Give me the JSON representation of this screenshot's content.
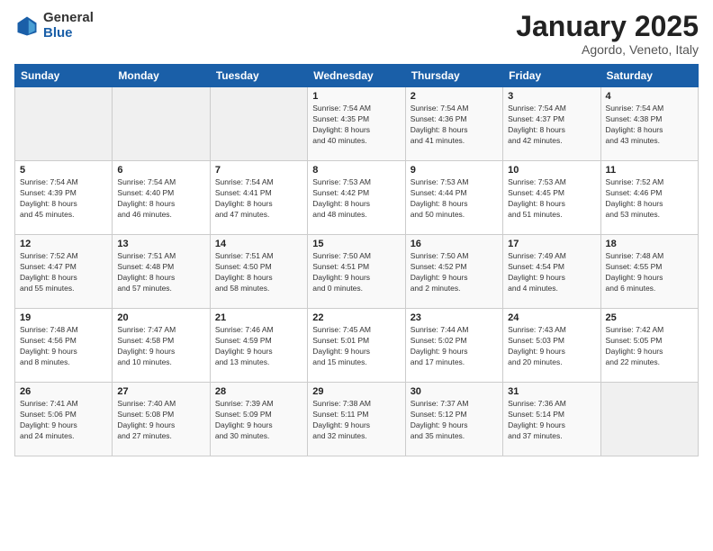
{
  "header": {
    "logo_general": "General",
    "logo_blue": "Blue",
    "month_title": "January 2025",
    "location": "Agordo, Veneto, Italy"
  },
  "weekdays": [
    "Sunday",
    "Monday",
    "Tuesday",
    "Wednesday",
    "Thursday",
    "Friday",
    "Saturday"
  ],
  "weeks": [
    [
      {
        "day": "",
        "info": ""
      },
      {
        "day": "",
        "info": ""
      },
      {
        "day": "",
        "info": ""
      },
      {
        "day": "1",
        "info": "Sunrise: 7:54 AM\nSunset: 4:35 PM\nDaylight: 8 hours\nand 40 minutes."
      },
      {
        "day": "2",
        "info": "Sunrise: 7:54 AM\nSunset: 4:36 PM\nDaylight: 8 hours\nand 41 minutes."
      },
      {
        "day": "3",
        "info": "Sunrise: 7:54 AM\nSunset: 4:37 PM\nDaylight: 8 hours\nand 42 minutes."
      },
      {
        "day": "4",
        "info": "Sunrise: 7:54 AM\nSunset: 4:38 PM\nDaylight: 8 hours\nand 43 minutes."
      }
    ],
    [
      {
        "day": "5",
        "info": "Sunrise: 7:54 AM\nSunset: 4:39 PM\nDaylight: 8 hours\nand 45 minutes."
      },
      {
        "day": "6",
        "info": "Sunrise: 7:54 AM\nSunset: 4:40 PM\nDaylight: 8 hours\nand 46 minutes."
      },
      {
        "day": "7",
        "info": "Sunrise: 7:54 AM\nSunset: 4:41 PM\nDaylight: 8 hours\nand 47 minutes."
      },
      {
        "day": "8",
        "info": "Sunrise: 7:53 AM\nSunset: 4:42 PM\nDaylight: 8 hours\nand 48 minutes."
      },
      {
        "day": "9",
        "info": "Sunrise: 7:53 AM\nSunset: 4:44 PM\nDaylight: 8 hours\nand 50 minutes."
      },
      {
        "day": "10",
        "info": "Sunrise: 7:53 AM\nSunset: 4:45 PM\nDaylight: 8 hours\nand 51 minutes."
      },
      {
        "day": "11",
        "info": "Sunrise: 7:52 AM\nSunset: 4:46 PM\nDaylight: 8 hours\nand 53 minutes."
      }
    ],
    [
      {
        "day": "12",
        "info": "Sunrise: 7:52 AM\nSunset: 4:47 PM\nDaylight: 8 hours\nand 55 minutes."
      },
      {
        "day": "13",
        "info": "Sunrise: 7:51 AM\nSunset: 4:48 PM\nDaylight: 8 hours\nand 57 minutes."
      },
      {
        "day": "14",
        "info": "Sunrise: 7:51 AM\nSunset: 4:50 PM\nDaylight: 8 hours\nand 58 minutes."
      },
      {
        "day": "15",
        "info": "Sunrise: 7:50 AM\nSunset: 4:51 PM\nDaylight: 9 hours\nand 0 minutes."
      },
      {
        "day": "16",
        "info": "Sunrise: 7:50 AM\nSunset: 4:52 PM\nDaylight: 9 hours\nand 2 minutes."
      },
      {
        "day": "17",
        "info": "Sunrise: 7:49 AM\nSunset: 4:54 PM\nDaylight: 9 hours\nand 4 minutes."
      },
      {
        "day": "18",
        "info": "Sunrise: 7:48 AM\nSunset: 4:55 PM\nDaylight: 9 hours\nand 6 minutes."
      }
    ],
    [
      {
        "day": "19",
        "info": "Sunrise: 7:48 AM\nSunset: 4:56 PM\nDaylight: 9 hours\nand 8 minutes."
      },
      {
        "day": "20",
        "info": "Sunrise: 7:47 AM\nSunset: 4:58 PM\nDaylight: 9 hours\nand 10 minutes."
      },
      {
        "day": "21",
        "info": "Sunrise: 7:46 AM\nSunset: 4:59 PM\nDaylight: 9 hours\nand 13 minutes."
      },
      {
        "day": "22",
        "info": "Sunrise: 7:45 AM\nSunset: 5:01 PM\nDaylight: 9 hours\nand 15 minutes."
      },
      {
        "day": "23",
        "info": "Sunrise: 7:44 AM\nSunset: 5:02 PM\nDaylight: 9 hours\nand 17 minutes."
      },
      {
        "day": "24",
        "info": "Sunrise: 7:43 AM\nSunset: 5:03 PM\nDaylight: 9 hours\nand 20 minutes."
      },
      {
        "day": "25",
        "info": "Sunrise: 7:42 AM\nSunset: 5:05 PM\nDaylight: 9 hours\nand 22 minutes."
      }
    ],
    [
      {
        "day": "26",
        "info": "Sunrise: 7:41 AM\nSunset: 5:06 PM\nDaylight: 9 hours\nand 24 minutes."
      },
      {
        "day": "27",
        "info": "Sunrise: 7:40 AM\nSunset: 5:08 PM\nDaylight: 9 hours\nand 27 minutes."
      },
      {
        "day": "28",
        "info": "Sunrise: 7:39 AM\nSunset: 5:09 PM\nDaylight: 9 hours\nand 30 minutes."
      },
      {
        "day": "29",
        "info": "Sunrise: 7:38 AM\nSunset: 5:11 PM\nDaylight: 9 hours\nand 32 minutes."
      },
      {
        "day": "30",
        "info": "Sunrise: 7:37 AM\nSunset: 5:12 PM\nDaylight: 9 hours\nand 35 minutes."
      },
      {
        "day": "31",
        "info": "Sunrise: 7:36 AM\nSunset: 5:14 PM\nDaylight: 9 hours\nand 37 minutes."
      },
      {
        "day": "",
        "info": ""
      }
    ]
  ]
}
